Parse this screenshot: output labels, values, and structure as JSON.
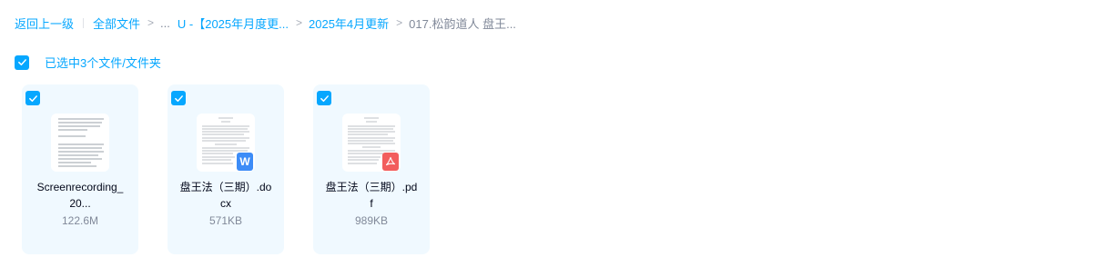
{
  "breadcrumb": {
    "back": "返回上一级",
    "all_files": "全部文件",
    "ellipsis": "...",
    "folder1": "U -【2025年月度更...",
    "folder2": "2025年4月更新",
    "current": "017.松韵道人 盘王..."
  },
  "selection": {
    "text": "已选中3个文件/文件夹"
  },
  "files": [
    {
      "name_line1": "Screenrecording_",
      "name_line2": "20...",
      "size": "122.6M",
      "type": "video"
    },
    {
      "name_line1": "盘王法（三期）.do",
      "name_line2": "cx",
      "size": "571KB",
      "type": "doc",
      "badge": "W"
    },
    {
      "name_line1": "盘王法（三期）.pd",
      "name_line2": "f",
      "size": "989KB",
      "type": "pdf"
    }
  ],
  "colors": {
    "accent": "#06a7ff",
    "card_bg": "#f0f9ff",
    "doc_badge": "#3d8cf7",
    "pdf_badge": "#f25d5d"
  }
}
